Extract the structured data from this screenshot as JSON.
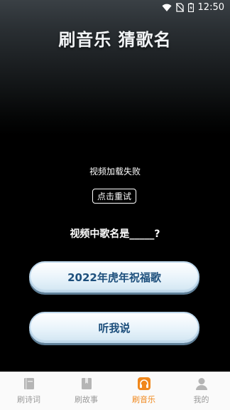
{
  "status_bar": {
    "time": "12:50"
  },
  "app": {
    "title": "刷音乐 猜歌名"
  },
  "video": {
    "error_text": "视频加载失败",
    "retry_label": "点击重试"
  },
  "quiz": {
    "question": "视频中歌名是_____?",
    "options": [
      {
        "label": "2022年虎年祝福歌"
      },
      {
        "label": "听我说"
      }
    ]
  },
  "tabbar": {
    "active_tab": "刷音乐",
    "tabs": [
      {
        "label": "刷诗词",
        "icon": "book-icon"
      },
      {
        "label": "刷故事",
        "icon": "bookmark-icon"
      },
      {
        "label": "刷音乐",
        "icon": "headphones-icon"
      },
      {
        "label": "我的",
        "icon": "person-icon"
      }
    ]
  },
  "colors": {
    "active_tab": "#f0871b",
    "inactive_tab": "#9a9a9a",
    "option_text": "#1d4f7c",
    "option_bg": "#e6f2fa"
  }
}
